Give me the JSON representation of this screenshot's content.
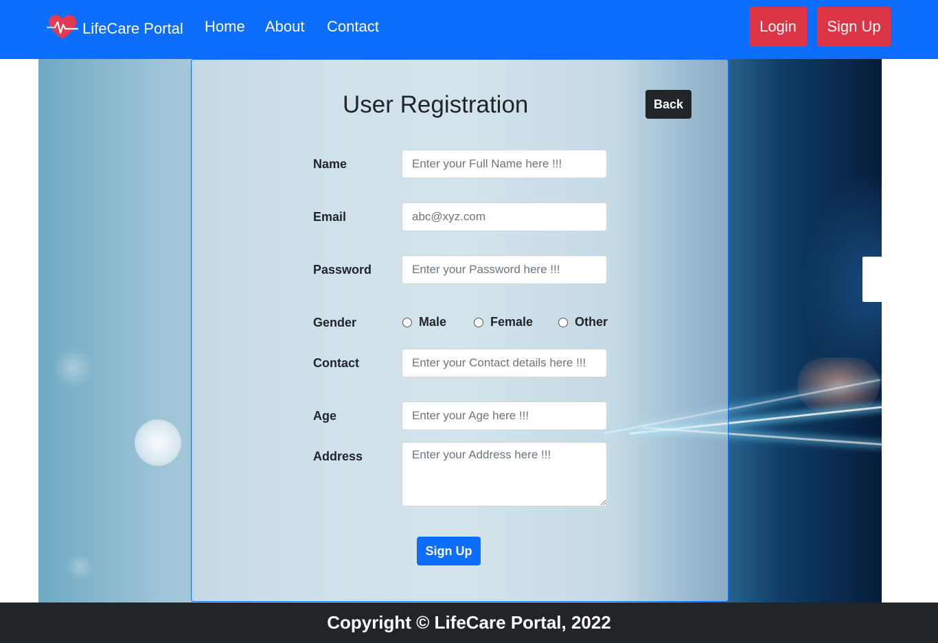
{
  "navbar": {
    "brand": "LifeCare Portal",
    "links": [
      "Home",
      "About",
      "Contact"
    ],
    "login_label": "Login",
    "signup_label": "Sign Up",
    "bg_color": "#0d6efd",
    "button_color": "#dc3545"
  },
  "form": {
    "title": "User Registration",
    "back_label": "Back",
    "fields": {
      "name": {
        "label": "Name",
        "placeholder": "Enter your Full Name here !!!"
      },
      "email": {
        "label": "Email",
        "placeholder": "abc@xyz.com"
      },
      "password": {
        "label": "Password",
        "placeholder": "Enter your Password here !!!"
      },
      "gender": {
        "label": "Gender",
        "options": [
          "Male",
          "Female",
          "Other"
        ]
      },
      "contact": {
        "label": "Contact",
        "placeholder": "Enter your Contact details here !!!"
      },
      "age": {
        "label": "Age",
        "placeholder": "Enter your Age here !!!"
      },
      "address": {
        "label": "Address",
        "placeholder": "Enter your Address here !!!"
      }
    },
    "submit_label": "Sign Up"
  },
  "footer": {
    "text": "Copyright © LifeCare Portal, 2022"
  },
  "icons": {
    "brand": "heartbeat-icon"
  }
}
